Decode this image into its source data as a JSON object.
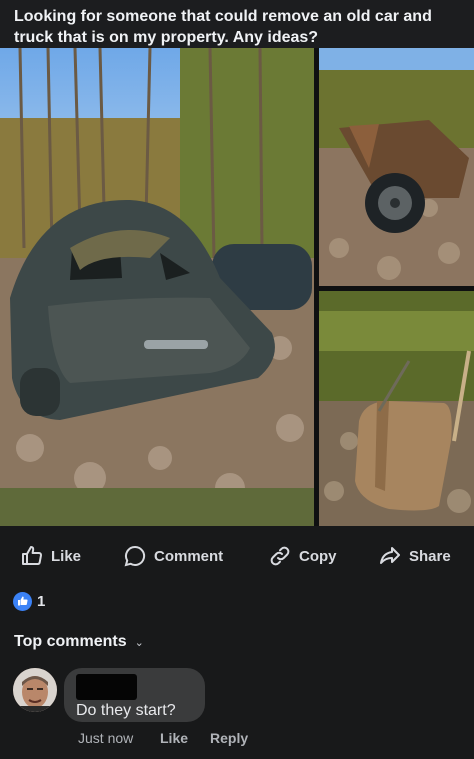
{
  "post": {
    "text": "Looking for someone that could remove an old car and truck that is on my property. Any ideas?"
  },
  "photos": [
    {
      "subject": "rusted-car-in-leaves"
    },
    {
      "subject": "old-truck-wheel"
    },
    {
      "subject": "truck-fender-in-leaves"
    }
  ],
  "actions": {
    "like": "Like",
    "comment": "Comment",
    "copy": "Copy",
    "share": "Share"
  },
  "reactions": {
    "icon": "thumbs-up-icon",
    "count": "1"
  },
  "comments_header": {
    "label": "Top comments"
  },
  "comment": {
    "text": "Do they start?",
    "time": "Just now",
    "like": "Like",
    "reply": "Reply"
  },
  "colors": {
    "background": "#18191a",
    "bubble": "#3a3b3c",
    "reaction_blue": "#3b82f6"
  }
}
